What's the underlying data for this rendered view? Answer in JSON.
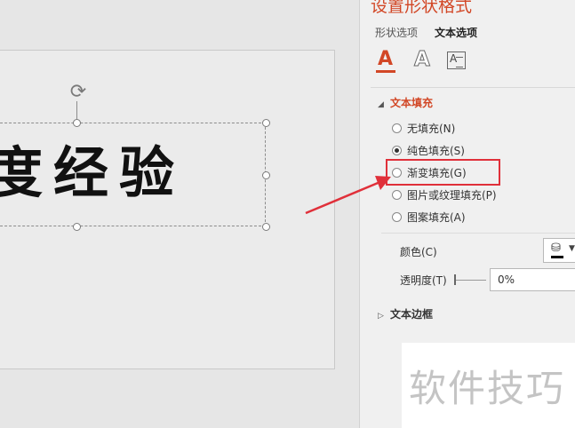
{
  "slide": {
    "title_text": "度经验"
  },
  "pane": {
    "title": "设置形状格式",
    "tabs": [
      "形状选项",
      "文本选项"
    ],
    "active_tab": "文本选项",
    "text_fill": {
      "heading": "文本填充",
      "options": [
        "无填充(N)",
        "纯色填充(S)",
        "渐变填充(G)",
        "图片或纹理填充(P)",
        "图案填充(A)"
      ],
      "selected": "纯色填充(S)",
      "color_label": "颜色(C)",
      "color_value": "#000000",
      "transparency_label": "透明度(T)",
      "transparency_value": "0%"
    },
    "text_border": {
      "heading": "文本边框"
    }
  },
  "annotation": {
    "highlighted_option": "渐变填充(G)",
    "color": "#e0303a"
  },
  "watermark": "软件技巧",
  "colors": {
    "accent": "#d24726",
    "pane_bg": "#f0f0f0",
    "canvas_bg": "#e6e6e6"
  },
  "icons": [
    "rotate-handle-icon",
    "text-fill-outline-icon",
    "text-effects-icon",
    "textbox-icon",
    "paint-bucket-icon"
  ]
}
